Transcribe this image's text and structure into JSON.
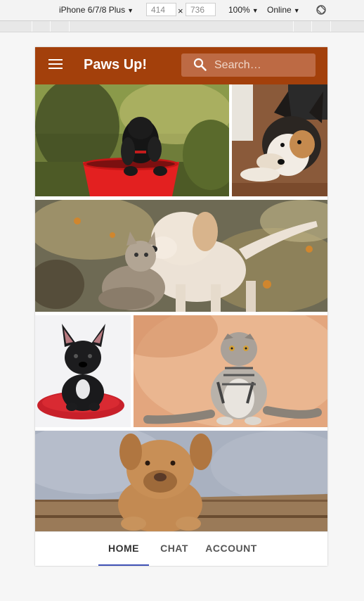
{
  "devtools": {
    "device": "iPhone 6/7/8 Plus",
    "width": "414",
    "height": "736",
    "times": "×",
    "zoom": "100%",
    "network": "Online"
  },
  "app": {
    "title": "Paws Up!",
    "search_placeholder": "Search…",
    "brand_color": "#a3400b",
    "accent_color": "#3f51b5"
  },
  "gallery": {
    "tiles": [
      {
        "subject": "black puppy in red bucket"
      },
      {
        "subject": "corgi lying on floor"
      },
      {
        "subject": "kitten and labrador puppy"
      },
      {
        "subject": "french bulldog on red cushion"
      },
      {
        "subject": "scottish fold cat sitting"
      },
      {
        "subject": "brown puppy in wooden crate"
      }
    ]
  },
  "nav": {
    "tabs": [
      {
        "label": "HOME",
        "active": true
      },
      {
        "label": "CHAT",
        "active": false
      },
      {
        "label": "ACCOUNT",
        "active": false
      }
    ]
  }
}
